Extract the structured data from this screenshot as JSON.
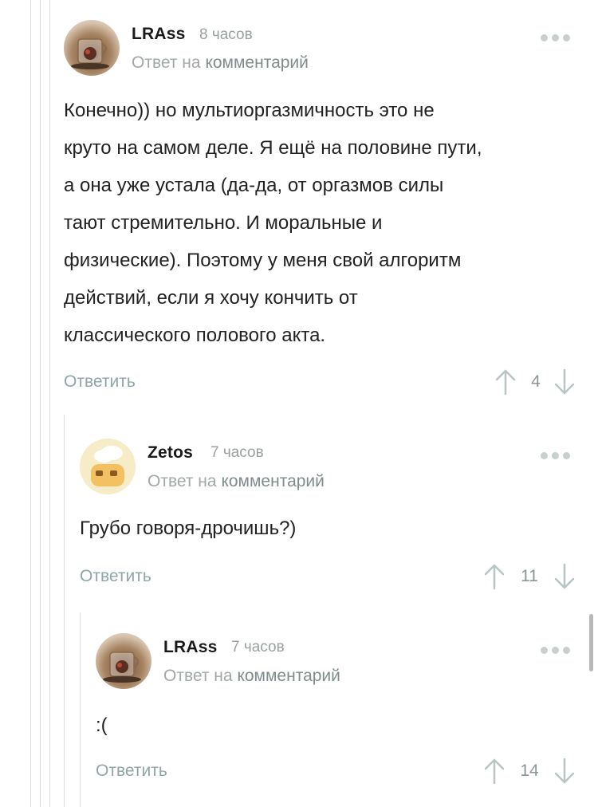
{
  "ui": {
    "reply_prefix": "Ответ на",
    "reply_link": "комментарий",
    "reply_button": "Ответить"
  },
  "comments": [
    {
      "author": "LRAss",
      "time": "8 часов",
      "avatar_icon": "tea-cup-avatar",
      "text": "Конечно)) но мультиоргазмичность это не\nкруто на самом деле. Я ещё на половине пути,\nа она уже устала (да-да, от оргазмов силы\nтают стремительно. И моральные и\nфизические). Поэтому у меня свой алгоритм\nдействий, если я хочу кончить от\nклассического полового акта.",
      "rating": "4"
    },
    {
      "author": "Zetos",
      "time": "7 часов",
      "avatar_icon": "chef-avatar",
      "text": "Грубо говоря-дрочишь?)",
      "rating": "11"
    },
    {
      "author": "LRAss",
      "time": "7 часов",
      "avatar_icon": "tea-cup-avatar",
      "text": ":(",
      "rating": "14"
    }
  ]
}
